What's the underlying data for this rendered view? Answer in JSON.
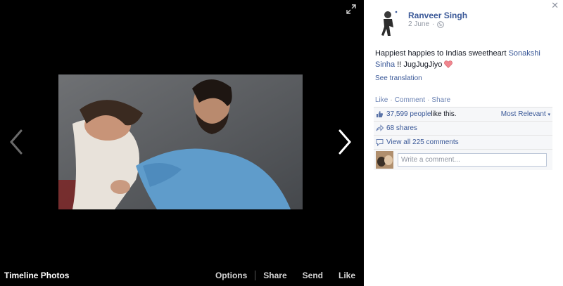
{
  "viewer": {
    "album_title": "Timeline Photos",
    "actions": [
      "Options",
      "Share",
      "Send",
      "Like"
    ],
    "icons": {
      "prev": "chevron-left-icon",
      "next": "chevron-right-icon",
      "fullscreen": "expand-icon"
    }
  },
  "post": {
    "author": "Ranveer Singh",
    "date": "2 June",
    "privacy_icon": "globe-icon",
    "text_before": "Happiest happies to Indias sweetheart ",
    "mention": "Sonakshi Sinha",
    "text_after": " !! JugJugJiyo ",
    "emoji": "heart-icon",
    "see_translation": "See translation"
  },
  "ufi": {
    "links": [
      "Like",
      "Comment",
      "Share"
    ],
    "likes_count": "37,599 people",
    "likes_suffix": " like this.",
    "sort_label": "Most Relevant",
    "shares": "68 shares",
    "view_comments": "View all 225 comments",
    "comment_placeholder": "Write a comment..."
  },
  "colors": {
    "link": "#3b5998",
    "heart": "#f0868f",
    "stage_bg": "#000000"
  }
}
